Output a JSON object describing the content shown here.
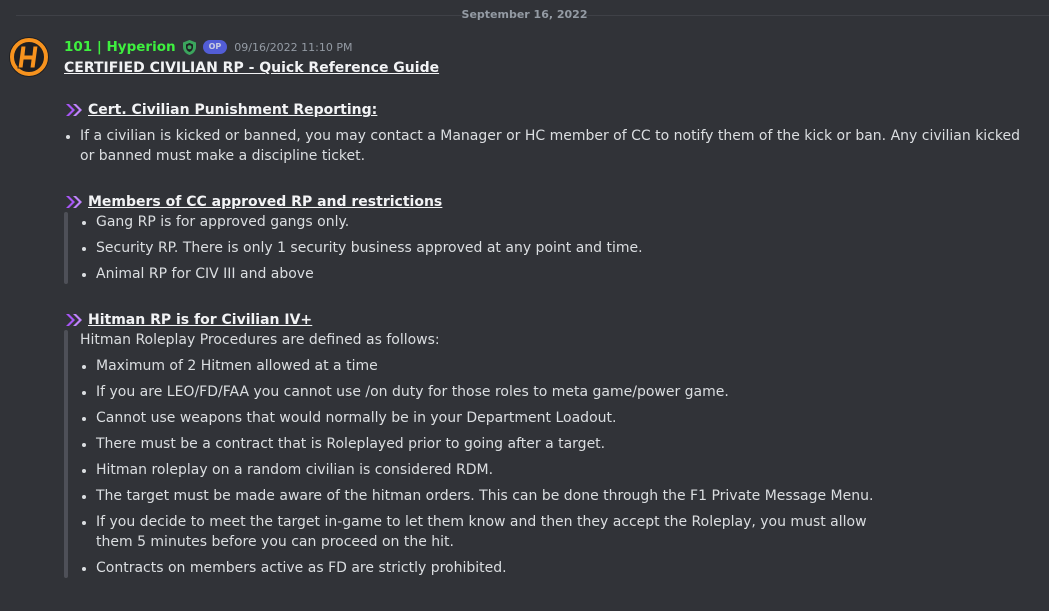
{
  "date_divider": "September 16, 2022",
  "message": {
    "author": "101 | Hyperion",
    "tag": "OP",
    "timestamp": "09/16/2022 11:10 PM",
    "title": "CERTIFIED CIVILIAN RP - Quick Reference Guide",
    "sections": [
      {
        "heading": "Cert. Civilian Punishment Reporting:",
        "items": [
          "If a civilian is kicked or banned, you may contact a Manager or HC member of CC to notify them of the kick or ban. Any civilian kicked or banned must make a discipline ticket."
        ]
      },
      {
        "heading": "Members of CC approved RP and restrictions",
        "items": [
          "Gang RP is for approved gangs only.",
          "Security RP. There is only 1 security business approved at any point and time.",
          "Animal RP for CIV III and above"
        ]
      },
      {
        "heading": "Hitman RP is for Civilian IV+",
        "intro": "Hitman Roleplay Procedures are defined as follows:",
        "items": [
          "Maximum of 2 Hitmen allowed at a time",
          "If you are LEO/FD/FAA you cannot use /on duty for those roles to meta game/power game.",
          "Cannot use weapons that would normally be in your Department Loadout.",
          "There must be a contract that is Roleplayed prior to going after a target.",
          "Hitman roleplay on a random civilian is considered RDM.",
          "The target must be made aware of the hitman orders. This can be done through the F1 Private Message Menu.",
          "If you decide to meet the target in-game to let them know and then they accept the Roleplay, you must allow them 5 minutes before you can proceed on the hit.",
          "Contracts on members active as FD are strictly prohibited."
        ]
      }
    ]
  },
  "colors": {
    "background": "#313338",
    "username": "#3ef03f",
    "heading_chevron": "#a855f7",
    "quote_bar": "#4e5058",
    "avatar_orange": "#f7931e"
  },
  "icons": {
    "avatar": "hyperion-logo",
    "role": "shield-icon",
    "heading_marker": "double-chevron-icon"
  }
}
